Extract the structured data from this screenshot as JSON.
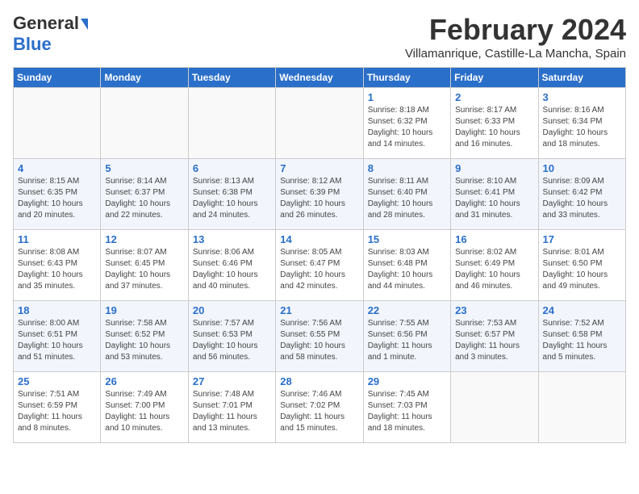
{
  "header": {
    "logo_general": "General",
    "logo_blue": "Blue",
    "month": "February 2024",
    "location": "Villamanrique, Castille-La Mancha, Spain"
  },
  "weekdays": [
    "Sunday",
    "Monday",
    "Tuesday",
    "Wednesday",
    "Thursday",
    "Friday",
    "Saturday"
  ],
  "weeks": [
    [
      {
        "day": "",
        "info": ""
      },
      {
        "day": "",
        "info": ""
      },
      {
        "day": "",
        "info": ""
      },
      {
        "day": "",
        "info": ""
      },
      {
        "day": "1",
        "info": "Sunrise: 8:18 AM\nSunset: 6:32 PM\nDaylight: 10 hours\nand 14 minutes."
      },
      {
        "day": "2",
        "info": "Sunrise: 8:17 AM\nSunset: 6:33 PM\nDaylight: 10 hours\nand 16 minutes."
      },
      {
        "day": "3",
        "info": "Sunrise: 8:16 AM\nSunset: 6:34 PM\nDaylight: 10 hours\nand 18 minutes."
      }
    ],
    [
      {
        "day": "4",
        "info": "Sunrise: 8:15 AM\nSunset: 6:35 PM\nDaylight: 10 hours\nand 20 minutes."
      },
      {
        "day": "5",
        "info": "Sunrise: 8:14 AM\nSunset: 6:37 PM\nDaylight: 10 hours\nand 22 minutes."
      },
      {
        "day": "6",
        "info": "Sunrise: 8:13 AM\nSunset: 6:38 PM\nDaylight: 10 hours\nand 24 minutes."
      },
      {
        "day": "7",
        "info": "Sunrise: 8:12 AM\nSunset: 6:39 PM\nDaylight: 10 hours\nand 26 minutes."
      },
      {
        "day": "8",
        "info": "Sunrise: 8:11 AM\nSunset: 6:40 PM\nDaylight: 10 hours\nand 28 minutes."
      },
      {
        "day": "9",
        "info": "Sunrise: 8:10 AM\nSunset: 6:41 PM\nDaylight: 10 hours\nand 31 minutes."
      },
      {
        "day": "10",
        "info": "Sunrise: 8:09 AM\nSunset: 6:42 PM\nDaylight: 10 hours\nand 33 minutes."
      }
    ],
    [
      {
        "day": "11",
        "info": "Sunrise: 8:08 AM\nSunset: 6:43 PM\nDaylight: 10 hours\nand 35 minutes."
      },
      {
        "day": "12",
        "info": "Sunrise: 8:07 AM\nSunset: 6:45 PM\nDaylight: 10 hours\nand 37 minutes."
      },
      {
        "day": "13",
        "info": "Sunrise: 8:06 AM\nSunset: 6:46 PM\nDaylight: 10 hours\nand 40 minutes."
      },
      {
        "day": "14",
        "info": "Sunrise: 8:05 AM\nSunset: 6:47 PM\nDaylight: 10 hours\nand 42 minutes."
      },
      {
        "day": "15",
        "info": "Sunrise: 8:03 AM\nSunset: 6:48 PM\nDaylight: 10 hours\nand 44 minutes."
      },
      {
        "day": "16",
        "info": "Sunrise: 8:02 AM\nSunset: 6:49 PM\nDaylight: 10 hours\nand 46 minutes."
      },
      {
        "day": "17",
        "info": "Sunrise: 8:01 AM\nSunset: 6:50 PM\nDaylight: 10 hours\nand 49 minutes."
      }
    ],
    [
      {
        "day": "18",
        "info": "Sunrise: 8:00 AM\nSunset: 6:51 PM\nDaylight: 10 hours\nand 51 minutes."
      },
      {
        "day": "19",
        "info": "Sunrise: 7:58 AM\nSunset: 6:52 PM\nDaylight: 10 hours\nand 53 minutes."
      },
      {
        "day": "20",
        "info": "Sunrise: 7:57 AM\nSunset: 6:53 PM\nDaylight: 10 hours\nand 56 minutes."
      },
      {
        "day": "21",
        "info": "Sunrise: 7:56 AM\nSunset: 6:55 PM\nDaylight: 10 hours\nand 58 minutes."
      },
      {
        "day": "22",
        "info": "Sunrise: 7:55 AM\nSunset: 6:56 PM\nDaylight: 11 hours\nand 1 minute."
      },
      {
        "day": "23",
        "info": "Sunrise: 7:53 AM\nSunset: 6:57 PM\nDaylight: 11 hours\nand 3 minutes."
      },
      {
        "day": "24",
        "info": "Sunrise: 7:52 AM\nSunset: 6:58 PM\nDaylight: 11 hours\nand 5 minutes."
      }
    ],
    [
      {
        "day": "25",
        "info": "Sunrise: 7:51 AM\nSunset: 6:59 PM\nDaylight: 11 hours\nand 8 minutes."
      },
      {
        "day": "26",
        "info": "Sunrise: 7:49 AM\nSunset: 7:00 PM\nDaylight: 11 hours\nand 10 minutes."
      },
      {
        "day": "27",
        "info": "Sunrise: 7:48 AM\nSunset: 7:01 PM\nDaylight: 11 hours\nand 13 minutes."
      },
      {
        "day": "28",
        "info": "Sunrise: 7:46 AM\nSunset: 7:02 PM\nDaylight: 11 hours\nand 15 minutes."
      },
      {
        "day": "29",
        "info": "Sunrise: 7:45 AM\nSunset: 7:03 PM\nDaylight: 11 hours\nand 18 minutes."
      },
      {
        "day": "",
        "info": ""
      },
      {
        "day": "",
        "info": ""
      }
    ]
  ]
}
